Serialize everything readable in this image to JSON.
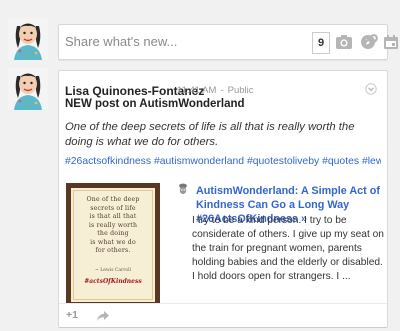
{
  "composer": {
    "placeholder": "Share what's new...",
    "count": "9",
    "icons": [
      "camera-icon",
      "video-icon",
      "event-icon",
      "link-icon"
    ]
  },
  "post": {
    "author": "Lisa Quinones-Fontanez",
    "time": "11:41 AM",
    "separator": "-",
    "visibility": "Public",
    "headline": "NEW post on AutismWonderland",
    "quote": "One of the deep secrets of life is all that is really worth the doing is what we do for others.",
    "hashtags": [
      "#26actsofkindness",
      "#autismwonderland",
      "#quotestoliveby",
      "#quotes",
      "#lewiscarroll"
    ],
    "thumbnail": {
      "lines": [
        "One of the deep",
        "secrets of life",
        "is that all that",
        "is really worth",
        "the doing",
        "is what we do",
        "for others."
      ],
      "credit": "~ Lewis Carroll",
      "tag": "#actsOfKindness"
    },
    "link": {
      "title": "AutismWonderland: A Simple Act of Kindness Can Go a Long Way #26ActsOfKindness »",
      "description": "I try to be a kind person. I try to be considerate of others. I give up my seat on the train for pregnant women, parents holding babies and the elderly or disabled. I hold doors open for strangers. I ..."
    },
    "actions": {
      "plus_one": "+1"
    }
  },
  "colors": {
    "link": "#3366cc",
    "background": "#f1f1f1",
    "icon_gray": "#b5b5b5"
  }
}
